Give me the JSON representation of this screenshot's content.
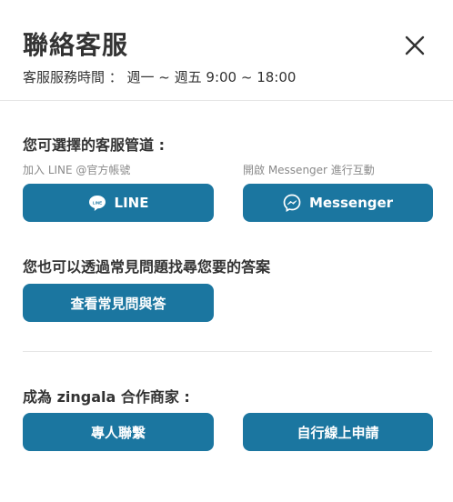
{
  "header": {
    "title": "聯絡客服",
    "hours": "客服服務時間 ： 週一 ~ 週五 9:00 ~ 18:00"
  },
  "channels": {
    "title": "您可選擇的客服管道 :",
    "line_hint": "加入 LINE @官方帳號",
    "line_label": "LINE",
    "messenger_hint": "開啟 Messenger 進行互動",
    "messenger_label": "Messenger"
  },
  "faq": {
    "title": "您也可以透過常見問題找尋您要的答案",
    "button_label": "查看常見問與答"
  },
  "partner": {
    "title": "成為 zingala 合作商家 :",
    "contact_label": "專人聯繫",
    "apply_label": "自行線上申請"
  },
  "colors": {
    "button_bg": "#1b76a0",
    "text": "#333333",
    "hint": "#8a8a8a"
  },
  "icons": [
    "close-icon",
    "line-icon",
    "messenger-icon"
  ]
}
